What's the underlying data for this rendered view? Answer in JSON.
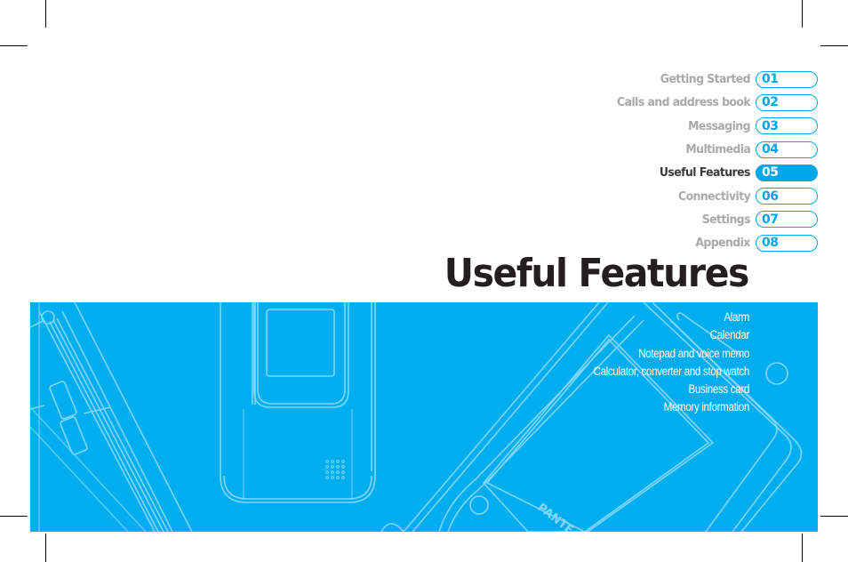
{
  "toc": {
    "items": [
      {
        "label": "Getting Started",
        "number": "01",
        "active": false
      },
      {
        "label": "Calls and address book",
        "number": "02",
        "active": false
      },
      {
        "label": "Messaging",
        "number": "03",
        "active": false
      },
      {
        "label": "Multimedia",
        "number": "04",
        "active": false
      },
      {
        "label": "Useful Features",
        "number": "05",
        "active": true
      },
      {
        "label": "Connectivity",
        "number": "06",
        "active": false
      },
      {
        "label": "Settings",
        "number": "07",
        "active": false
      },
      {
        "label": "Appendix",
        "number": "08",
        "active": false
      }
    ]
  },
  "chapter": {
    "title": "Useful Features",
    "features": [
      "Alarm",
      "Calendar",
      "Notepad and voice memo",
      "Calculator, converter and stop watch",
      "Business card",
      "Memory information"
    ]
  },
  "illustration": {
    "brand_text": "PANTE"
  },
  "colors": {
    "accent": "#00a6e8",
    "panel": "#00aeef",
    "inactive_text": "#a9a9a9",
    "active_text": "#3a3a3a",
    "title_text": "#231f20"
  }
}
